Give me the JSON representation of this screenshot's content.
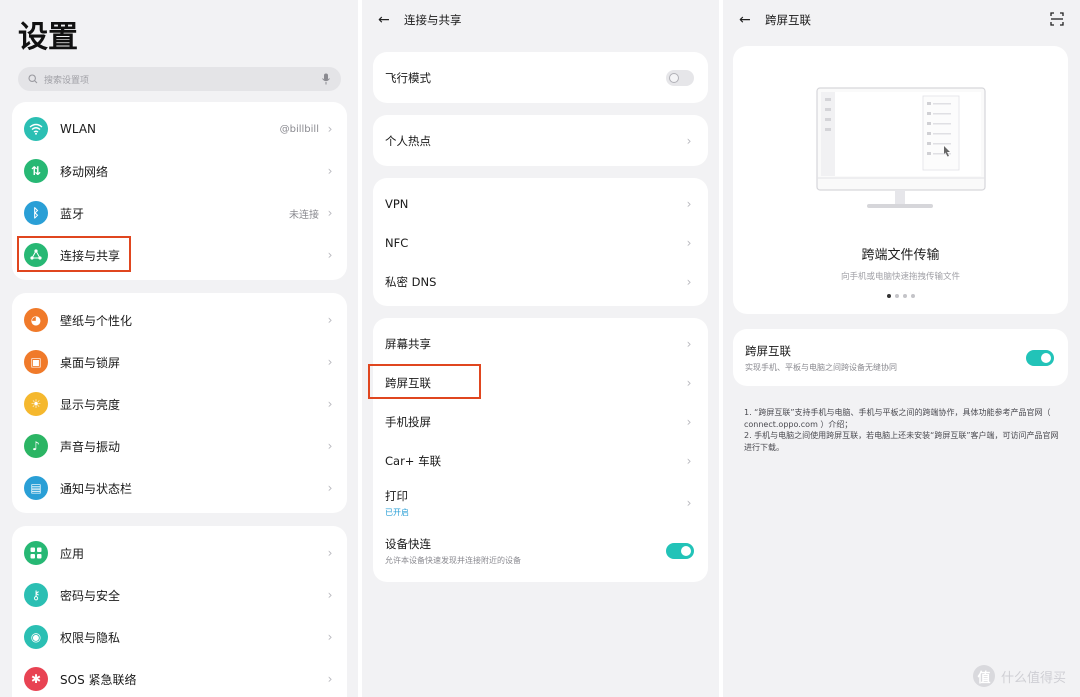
{
  "settings": {
    "title": "设置",
    "search_placeholder": "搜索设置项",
    "group1": [
      {
        "label": "WLAN",
        "value": "@billbill",
        "icon": "wifi-icon",
        "color": "#2bbfb3"
      },
      {
        "label": "移动网络",
        "value": "",
        "icon": "signal-icon",
        "color": "#27b874"
      },
      {
        "label": "蓝牙",
        "value": "未连接",
        "icon": "bluetooth-icon",
        "color": "#2a9fd6"
      },
      {
        "label": "连接与共享",
        "value": "",
        "icon": "share-icon",
        "color": "#27b874"
      }
    ],
    "group2": [
      {
        "label": "壁纸与个性化",
        "icon": "palette-icon",
        "color": "#f07a2a"
      },
      {
        "label": "桌面与锁屏",
        "icon": "picture-icon",
        "color": "#f07a2a"
      },
      {
        "label": "显示与亮度",
        "icon": "sun-icon",
        "color": "#f5b82e"
      },
      {
        "label": "声音与振动",
        "icon": "bell-icon",
        "color": "#2bb564"
      },
      {
        "label": "通知与状态栏",
        "icon": "notification-icon",
        "color": "#2a9fd6"
      }
    ],
    "group3": [
      {
        "label": "应用",
        "icon": "apps-icon",
        "color": "#27b874"
      },
      {
        "label": "密码与安全",
        "icon": "key-icon",
        "color": "#2bbfb3"
      },
      {
        "label": "权限与隐私",
        "icon": "eye-icon",
        "color": "#2bbfb3"
      },
      {
        "label": "SOS 紧急联络",
        "icon": "sos-icon",
        "color": "#e84353"
      }
    ]
  },
  "connection": {
    "title": "连接与共享",
    "airplane": "飞行模式",
    "hotspot": "个人热点",
    "vpn": "VPN",
    "nfc": "NFC",
    "dns": "私密 DNS",
    "screen_share": "屏幕共享",
    "cross_screen": "跨屏互联",
    "cast": "手机投屏",
    "carplus": "Car+ 车联",
    "print": "打印",
    "print_status": "已开启",
    "quick_connect": "设备快连",
    "quick_connect_desc": "允许本设备快速发现并连接附近的设备"
  },
  "cross": {
    "title": "跨屏互联",
    "illus_title": "跨端文件传输",
    "illus_sub": "向手机或电脑快速拖拽传输文件",
    "toggle_label": "跨屏互联",
    "toggle_desc": "实现手机、平板与电脑之间跨设备无缝协同",
    "note1": "1. “跨屏互联”支持手机与电脑、手机与平板之间的跨端协作，具体功能参考产品官网（ connect.oppo.com ）介绍；",
    "note2": "2. 手机与电脑之间使用跨屏互联，若电脑上还未安装“跨屏互联”客户端，可访问产品官网进行下载。"
  },
  "watermark": {
    "text": "什么值得买",
    "glyph": "值"
  },
  "colors": {
    "highlight": "#e0461f",
    "toggle_on": "#22c3b8"
  }
}
